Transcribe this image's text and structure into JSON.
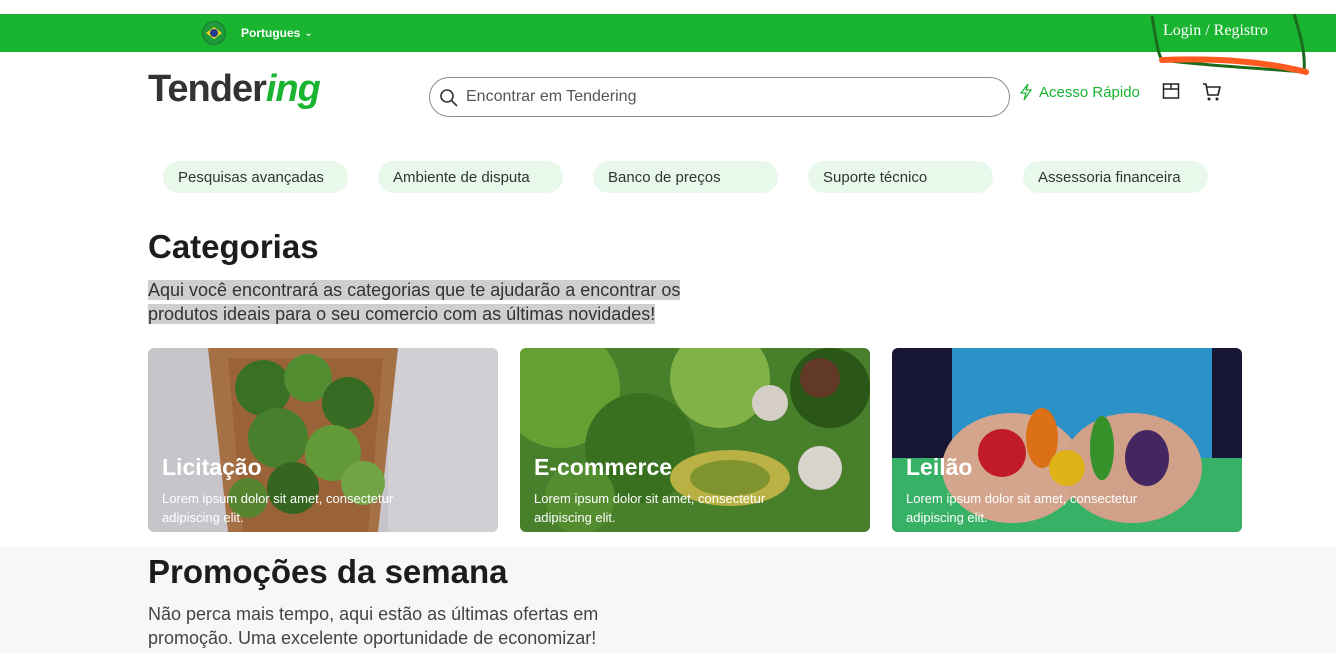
{
  "topbar": {
    "language": "Portugues",
    "login": "Login / Registro",
    "accent": "#19b531"
  },
  "header": {
    "logo_main": "Tender",
    "logo_accent": "ing",
    "search_placeholder": "Encontrar em Tendering",
    "quick_access": "Acesso Rápido"
  },
  "nav_pills": [
    "Pesquisas avançadas",
    "Ambiente de disputa",
    "Banco de preços",
    "Suporte técnico",
    "Assessoria financeira"
  ],
  "categories": {
    "title": "Categorias",
    "description": "Aqui você encontrará as categorias que te ajudarão a encontrar os produtos ideais para o seu comercio com as últimas novidades!",
    "cards": [
      {
        "title": "Licitação",
        "text": "Lorem ipsum dolor sit amet, consectetur adipiscing elit."
      },
      {
        "title": "E-commerce",
        "text": "Lorem ipsum dolor sit amet, consectetur adipiscing elit."
      },
      {
        "title": "Leilão",
        "text": "Lorem ipsum dolor sit amet, consectetur adipiscing elit."
      }
    ]
  },
  "promotions": {
    "title": "Promoções da semana",
    "description": "Não perca mais tempo, aqui estão as últimas ofertas em promoção. Uma excelente oportunidade de economizar!"
  }
}
